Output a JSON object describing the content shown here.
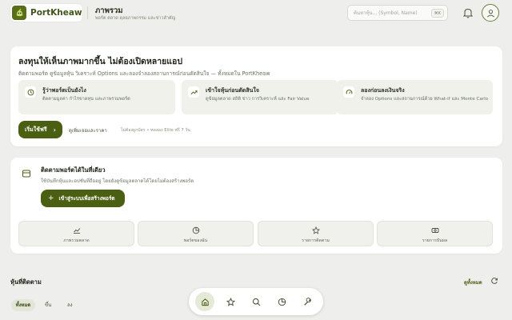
{
  "colors": {
    "brand": "#4b5f12",
    "background": "#eeefec",
    "card": "#ffffff",
    "feature_bg": "#eff1ea"
  },
  "header": {
    "logo_text": "PortKheaw",
    "title": "ภาพรวม",
    "subtitle": "พอร์ต ตลาด ดุลยภาพกรรม และข่าวสำคัญ",
    "search_placeholder": "ค้นหาหุ้น... (Symbol, Name)",
    "search_shortcut": "⌘K",
    "icons": [
      "logo-icon",
      "search-icon",
      "bell-icon",
      "user-icon"
    ]
  },
  "hero": {
    "title": "ลงทุนให้เห็นภาพมากขึ้น ไม่ต้องเปิดหลายแอป",
    "description": "ติดตามพอร์ต ดูข้อมูลหุ้น วิเคราะห์ Options และลองจำลองสถานการณ์ก่อนตัดสินใจ — ทั้งหมดใน PortKheaw",
    "features": [
      {
        "icon": "clock-icon",
        "title": "รู้ว่าพอร์ตเป็นยังไง",
        "description": "ติดตามมูลค่า กำไรขาดทุน และภาพรวมพอร์ต"
      },
      {
        "icon": "trend-icon",
        "title": "เข้าใจหุ้นก่อนตัดสินใจ",
        "description": "ดูข้อมูลตลาด สถิติ ข่าว การวิเคราะห์ และ Fair Value"
      },
      {
        "icon": "gauge-icon",
        "title": "ลองก่อนลงเงินจริง",
        "description": "จำลอง Options และสถานการณ์ด้วย What-if และ Monte Carlo"
      }
    ],
    "start_button": "เริ่มใช้ฟรี",
    "compare_link": "ดูเพิ่มเจอและราคา",
    "note": "ไม่ต้องผูกบัตร • ทดลอง Elite ฟรี 7 วัน"
  },
  "portfolio_card": {
    "title": "ติดตามพอร์ตได้ในที่เดียว",
    "description": "ใช้บันทึกหุ้นและอปชั่นที่ถืออยู่ โดยยังดูข้อมูลตลาดได้โดยไม่ต้องสร้างพอร์ต",
    "connect_button": "เข้าสู่ระบบเพื่อสร้างพอร์ต",
    "quick_links": [
      {
        "icon": "chart-icon",
        "label": "ภาพรวมตลาด"
      },
      {
        "icon": "pie-icon",
        "label": "พอร์ตของฉัน"
      },
      {
        "icon": "star-icon",
        "label": "รายการติดตาม"
      },
      {
        "icon": "cash-icon",
        "label": "รายการปันผล"
      }
    ]
  },
  "watchlist": {
    "title": "หุ้นที่ติดตาม",
    "view_all": "ดูทั้งหมด",
    "tabs": [
      "ทั้งหมด",
      "ขึ้น",
      "ลง"
    ],
    "active_tab": "ทั้งหมด"
  },
  "bottom_nav": {
    "items": [
      "home-icon",
      "star-icon",
      "search-icon",
      "pie-icon",
      "wrench-icon"
    ],
    "active": "home-icon"
  }
}
